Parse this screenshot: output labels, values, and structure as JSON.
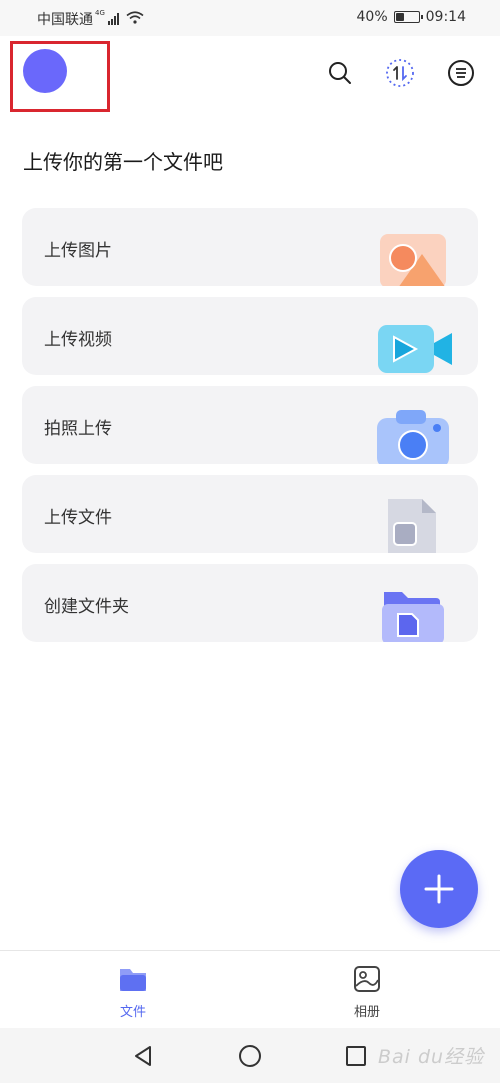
{
  "status_bar": {
    "carrier": "中国联通",
    "network": "4G",
    "battery": "40%",
    "battery_level": 0.4,
    "time": "09:14"
  },
  "header": {
    "icons": [
      "search-icon",
      "transfer-icon",
      "menu-icon"
    ]
  },
  "main": {
    "section_title": "上传你的第一个文件吧",
    "actions": [
      {
        "label": "上传图片",
        "icon": "image-icon",
        "color": "#f9a77f"
      },
      {
        "label": "上传视频",
        "icon": "video-icon",
        "color": "#4cc7ee"
      },
      {
        "label": "拍照上传",
        "icon": "camera-icon",
        "color": "#5d8dfa"
      },
      {
        "label": "上传文件",
        "icon": "document-icon",
        "color": "#b9bed0"
      },
      {
        "label": "创建文件夹",
        "icon": "folder-icon",
        "color": "#6a74f3"
      }
    ]
  },
  "fab": {
    "icon": "plus-icon",
    "color": "#5b6af5"
  },
  "bottom_nav": {
    "items": [
      {
        "label": "文件",
        "icon": "folder-icon",
        "active": true
      },
      {
        "label": "相册",
        "icon": "album-icon",
        "active": false
      }
    ]
  },
  "watermark": "Bai du经验",
  "colors": {
    "accent": "#5468f0",
    "avatar": "#6a68fb",
    "highlight": "#d9262f"
  }
}
